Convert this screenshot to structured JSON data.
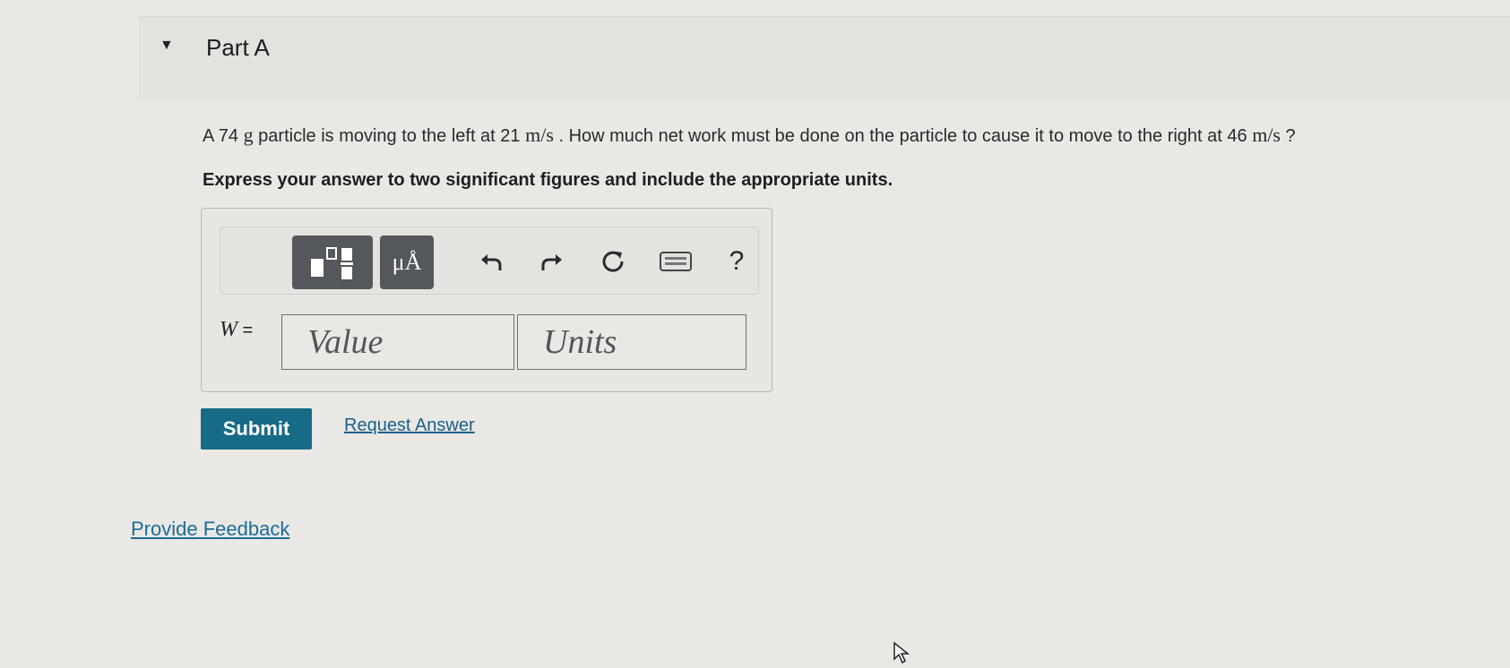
{
  "part": {
    "title": "Part A",
    "question_prefix": "A 74 ",
    "question_unit_g": "g",
    "question_mid1": " particle is moving to the left at 21 ",
    "question_unit_ms1": "m/s",
    "question_mid2": " . How much net work must be done on the particle to cause it to move to the right at 46 ",
    "question_unit_ms2": "m/s",
    "question_suffix": " ?",
    "instruction": "Express your answer to two significant figures and include the appropriate units."
  },
  "toolbar": {
    "units_label": "μÅ",
    "help_label": "?"
  },
  "answer": {
    "variable": "W",
    "equals": " =",
    "value_placeholder": "Value",
    "units_placeholder": "Units"
  },
  "actions": {
    "submit_label": "Submit",
    "request_answer_label": "Request Answer"
  },
  "footer": {
    "feedback_label": "Provide Feedback"
  },
  "colors": {
    "submit_bg": "#176b87",
    "link": "#1b5f8a"
  }
}
